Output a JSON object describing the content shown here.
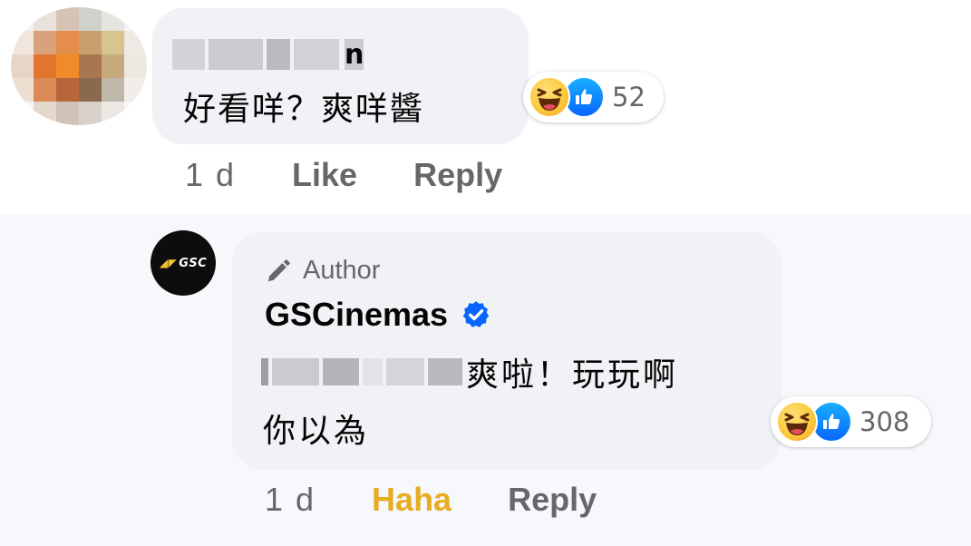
{
  "comment": {
    "author_visible_tail": "n",
    "text": "好看咩？爽咩醬",
    "reaction_count": "52",
    "time": "1 d",
    "like_label": "Like",
    "reply_label": "Reply"
  },
  "reply": {
    "badge_label": "Author",
    "page_name": "GSCinemas",
    "avatar_logo_text": "GSC",
    "text_line1": "爽啦！玩玩啊",
    "text_line2": "你以為",
    "reaction_count": "308",
    "time": "1 d",
    "reacted_label": "Haha",
    "reply_label": "Reply"
  },
  "colors": {
    "bubble": "#f0f2f5",
    "muted_text": "#65676b",
    "haha_active": "#e8ac22",
    "verified_blue": "#0866ff",
    "reply_background": "#f6f8fb"
  },
  "icons": [
    "haha-reaction-icon",
    "like-reaction-icon",
    "pencil-icon",
    "verified-badge-icon"
  ]
}
